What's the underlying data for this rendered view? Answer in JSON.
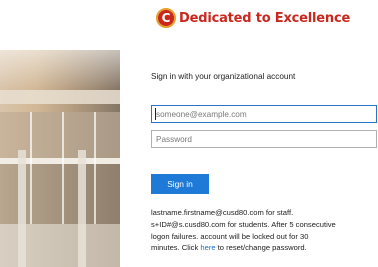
{
  "branding": {
    "logo_letter": "C",
    "logo_text": "Dedicated to Excellence",
    "logo_color": "#c8281e",
    "logo_ring_color": "#e8a030"
  },
  "form": {
    "heading": "Sign in with your organizational account",
    "email_placeholder": "someone@example.com",
    "email_value": "",
    "password_placeholder": "Password",
    "password_value": "",
    "submit_label": "Sign in",
    "accent_color": "#1e7ad6"
  },
  "help": {
    "line1": "lastname.firstname@cusd80.com for staff.",
    "line2": "s+ID#@s.cusd80.com for students. After 5 consecutive",
    "line3": "logon failures. account will be locked out for 30",
    "line4_before": "minutes. Click ",
    "link_text": "here",
    "line4_after": " to reset/change password."
  }
}
